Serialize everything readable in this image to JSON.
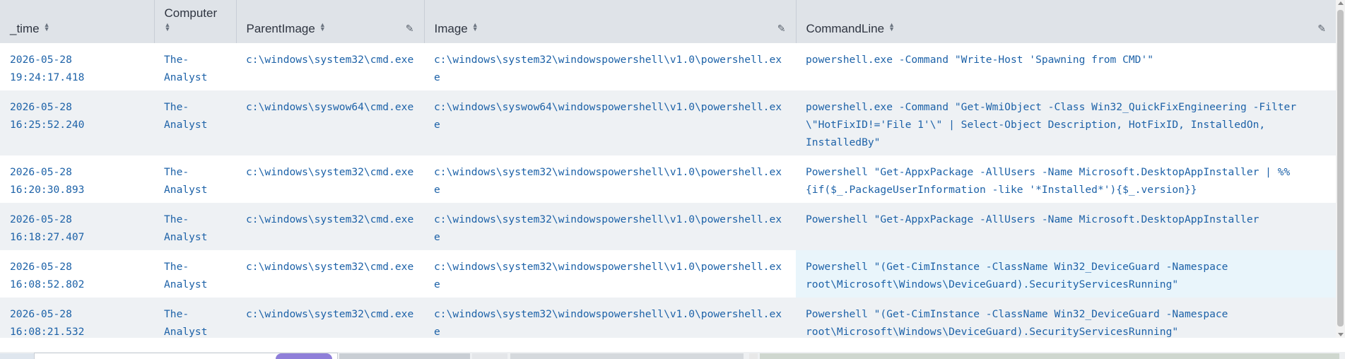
{
  "columns": [
    {
      "label": "_time"
    },
    {
      "label": "Computer"
    },
    {
      "label": "ParentImage"
    },
    {
      "label": "Image"
    },
    {
      "label": "CommandLine"
    }
  ],
  "rows": [
    {
      "time_date": "2026-05-28",
      "time_clock": "19:24:17.418",
      "computer_a": "The-",
      "computer_b": "Analyst",
      "parent": "c:\\windows\\system32\\cmd.exe",
      "image": "c:\\windows\\system32\\windowspowershell\\v1.0\\powershell.exe",
      "cmd": "powershell.exe  -Command \"Write-Host 'Spawning from CMD'\""
    },
    {
      "time_date": "2026-05-28",
      "time_clock": "16:25:52.240",
      "computer_a": "The-",
      "computer_b": "Analyst",
      "parent": "c:\\windows\\syswow64\\cmd.exe",
      "image": "c:\\windows\\syswow64\\windowspowershell\\v1.0\\powershell.exe",
      "cmd": "powershell.exe  -Command \"Get-WmiObject -Class Win32_QuickFixEngineering -Filter \\\"HotFixID!='File 1'\\\" | Select-Object Description, HotFixID, InstalledOn, InstalledBy\""
    },
    {
      "time_date": "2026-05-28",
      "time_clock": "16:20:30.893",
      "computer_a": "The-",
      "computer_b": "Analyst",
      "parent": "c:\\windows\\system32\\cmd.exe",
      "image": "c:\\windows\\system32\\windowspowershell\\v1.0\\powershell.exe",
      "cmd": "Powershell  \"Get-AppxPackage -AllUsers -Name Microsoft.DesktopAppInstaller | %%{if($_.PackageUserInformation -like '*Installed*'){$_.version}}"
    },
    {
      "time_date": "2026-05-28",
      "time_clock": "16:18:27.407",
      "computer_a": "The-",
      "computer_b": "Analyst",
      "parent": "c:\\windows\\system32\\cmd.exe",
      "image": "c:\\windows\\system32\\windowspowershell\\v1.0\\powershell.exe",
      "cmd": "Powershell  \"Get-AppxPackage -AllUsers -Name Microsoft.DesktopAppInstaller"
    },
    {
      "time_date": "2026-05-28",
      "time_clock": "16:08:52.802",
      "computer_a": "The-",
      "computer_b": "Analyst",
      "parent": "c:\\windows\\system32\\cmd.exe",
      "image": "c:\\windows\\system32\\windowspowershell\\v1.0\\powershell.exe",
      "cmd": "Powershell  \"(Get-CimInstance -ClassName Win32_DeviceGuard -Namespace root\\Microsoft\\Windows\\DeviceGuard).SecurityServicesRunning\""
    },
    {
      "time_date": "2026-05-28",
      "time_clock": "16:08:21.532",
      "computer_a": "The-",
      "computer_b": "Analyst",
      "parent": "c:\\windows\\system32\\cmd.exe",
      "image": "c:\\windows\\system32\\windowspowershell\\v1.0\\powershell.exe",
      "cmd": "Powershell  \"(Get-CimInstance -ClassName Win32_DeviceGuard -Namespace root\\Microsoft\\Windows\\DeviceGuard).SecurityServicesRunning\""
    }
  ],
  "icons": {
    "sort": "sort-icon",
    "edit": "pencil-icon"
  },
  "colors": {
    "header_bg": "#dfe3e8",
    "link_text": "#1d62a8",
    "row_alt": "#eef1f4",
    "row_highlight": "#e9f5fb"
  }
}
